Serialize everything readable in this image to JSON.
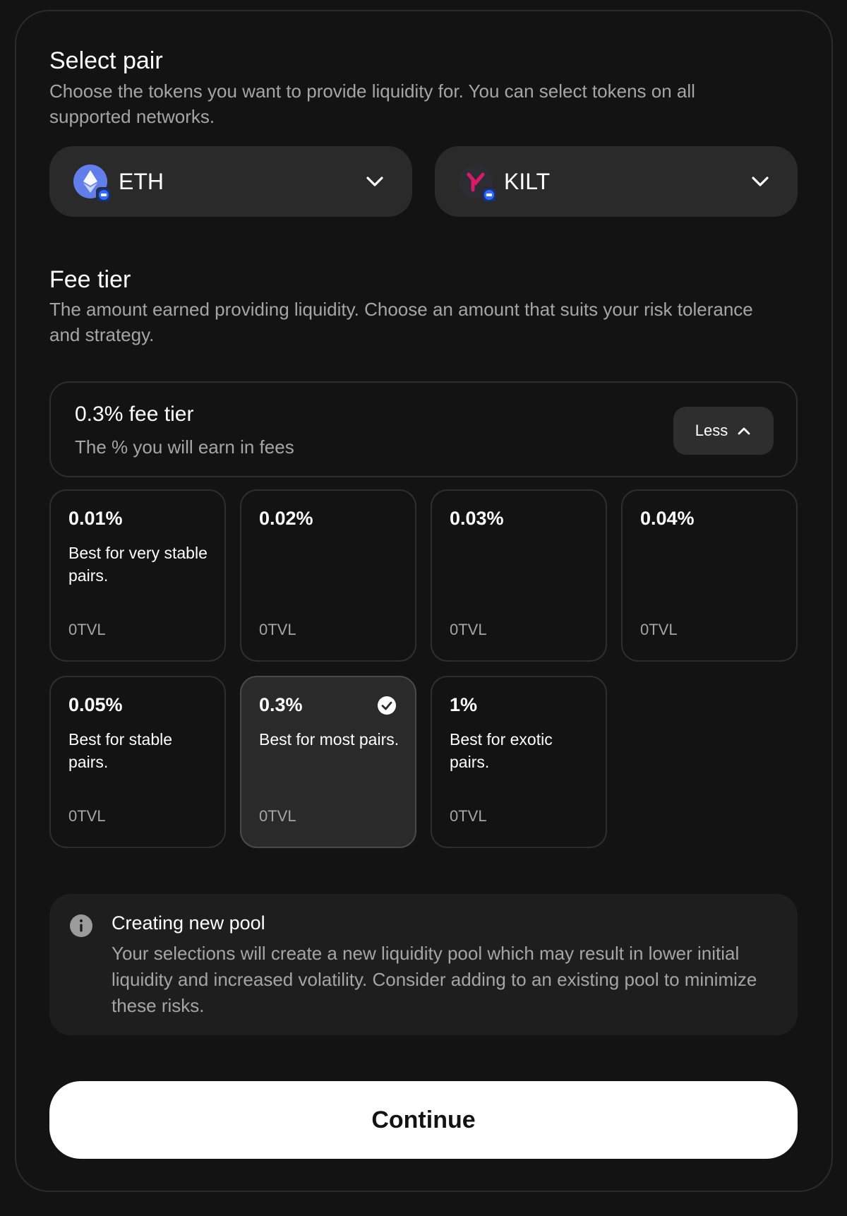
{
  "select_pair": {
    "title": "Select pair",
    "description": "Choose the tokens you want to provide liquidity for. You can select tokens on all supported networks."
  },
  "tokens": [
    {
      "symbol": "ETH",
      "icon": "eth-icon",
      "color": "#627EEA"
    },
    {
      "symbol": "KILT",
      "icon": "kilt-icon",
      "color": "#D91A6C"
    }
  ],
  "fee_section": {
    "title": "Fee tier",
    "description": "The amount earned providing liquidity. Choose an amount that suits your risk tolerance and strategy."
  },
  "fee_box": {
    "title": "0.3% fee tier",
    "subtitle": "The % you will earn in fees",
    "toggle_label": "Less"
  },
  "tiers": [
    {
      "value": "0.01%",
      "description": "Best for very stable pairs.",
      "tvl": "0TVL",
      "selected": false
    },
    {
      "value": "0.02%",
      "description": "",
      "tvl": "0TVL",
      "selected": false
    },
    {
      "value": "0.03%",
      "description": "",
      "tvl": "0TVL",
      "selected": false
    },
    {
      "value": "0.04%",
      "description": "",
      "tvl": "0TVL",
      "selected": false
    },
    {
      "value": "0.05%",
      "description": "Best for stable pairs.",
      "tvl": "0TVL",
      "selected": false
    },
    {
      "value": "0.3%",
      "description": "Best for most pairs.",
      "tvl": "0TVL",
      "selected": true
    },
    {
      "value": "1%",
      "description": "Best for exotic pairs.",
      "tvl": "0TVL",
      "selected": false
    }
  ],
  "notice": {
    "title": "Creating new pool",
    "body": "Your selections will create a new liquidity pool which may result in lower initial liquidity and increased volatility. Consider adding to an existing pool to minimize these risks."
  },
  "continue_label": "Continue"
}
